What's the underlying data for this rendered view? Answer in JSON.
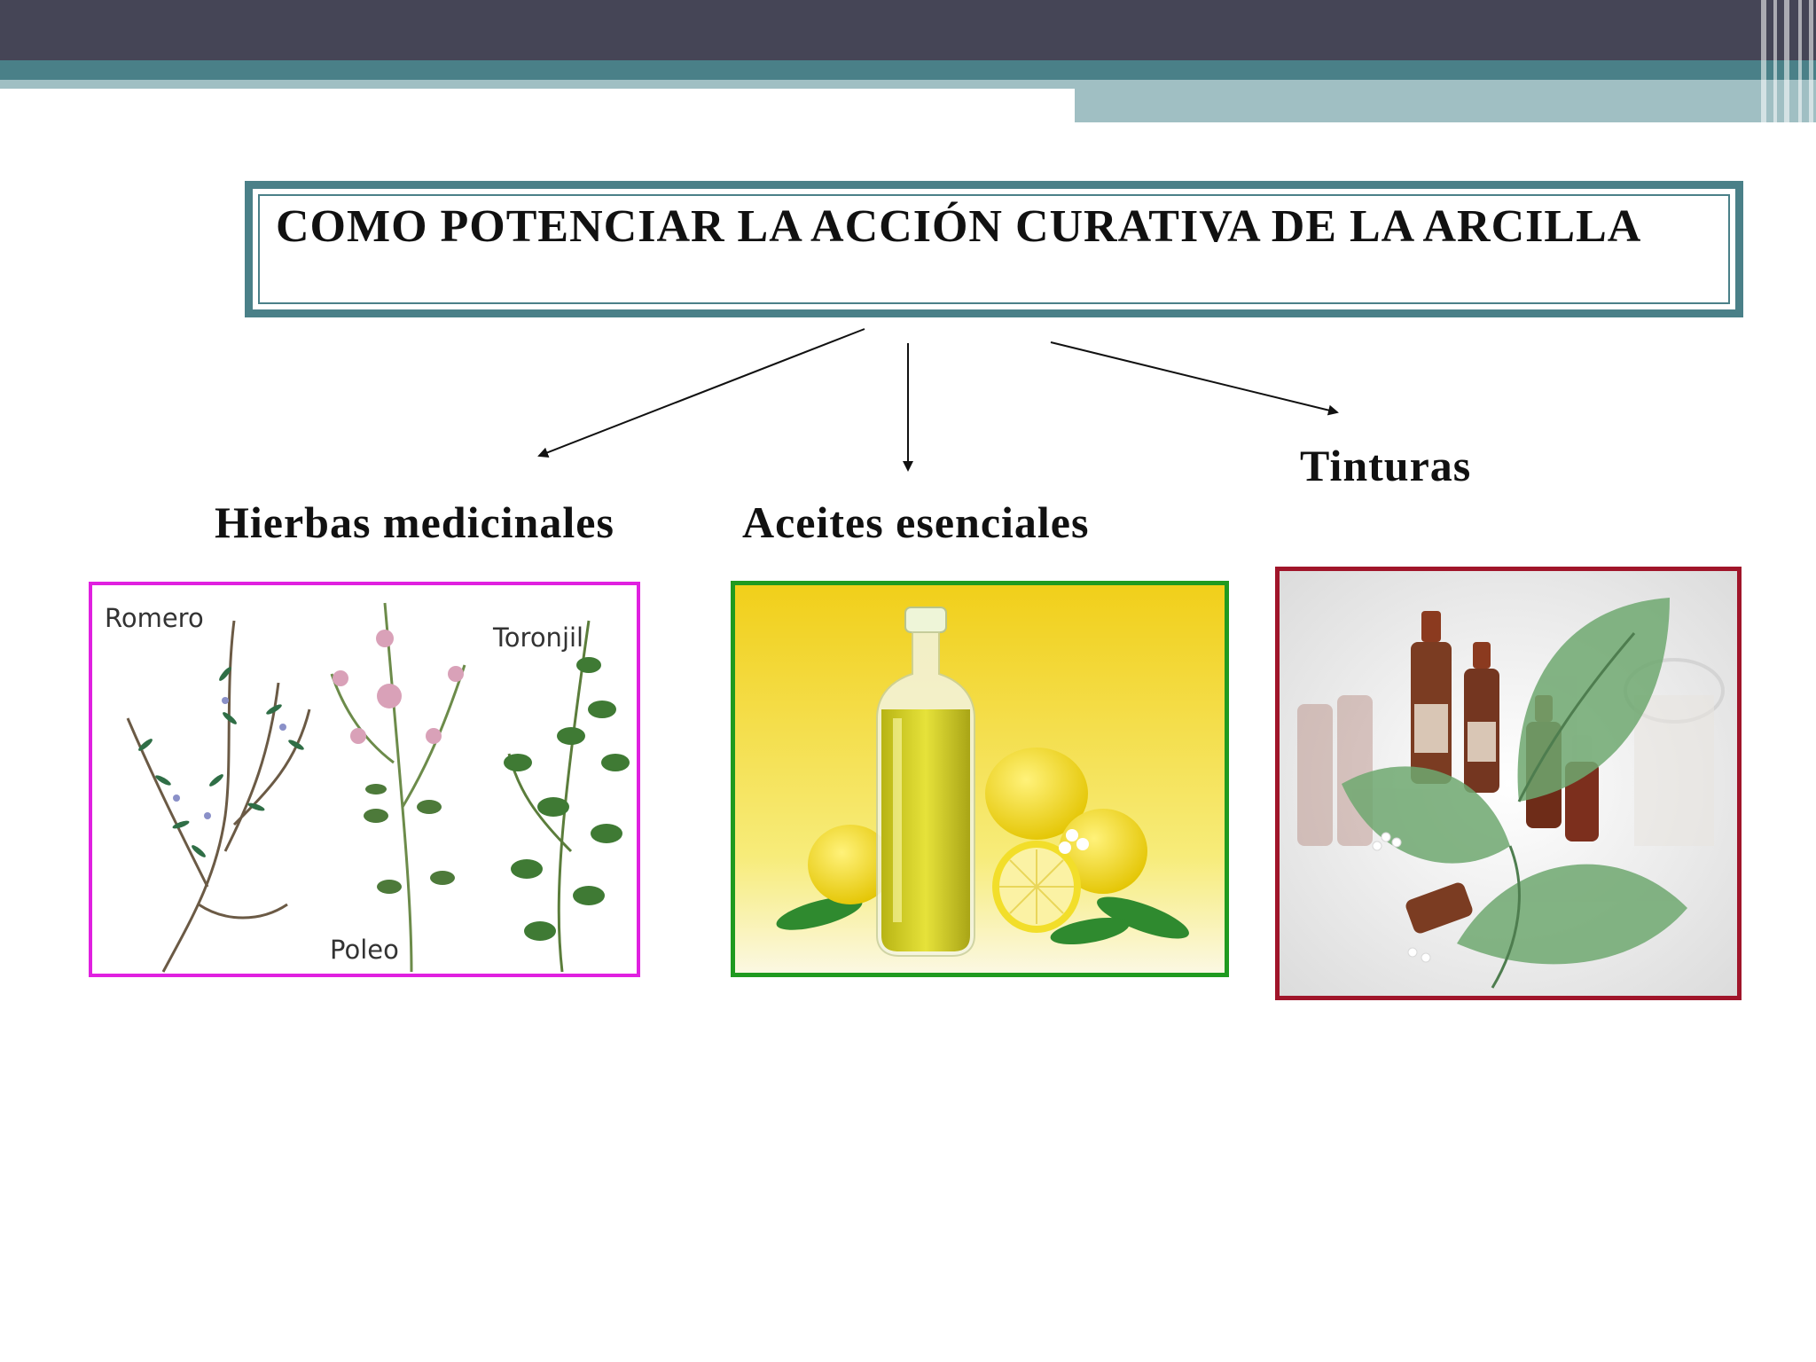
{
  "slide": {
    "title": "COMO POTENCIAR LA ACCIÓN CURATIVA DE LA ARCILLA",
    "branches": [
      {
        "label": "Hierbas medicinales"
      },
      {
        "label": "Aceites esenciales"
      },
      {
        "label": "Tinturas"
      }
    ],
    "herbs_image": {
      "names": [
        "Romero",
        "Toronjil",
        "Poleo"
      ],
      "border_color": "#e020e0"
    },
    "oils_image": {
      "border_color": "#1f9a1f"
    },
    "tinctures_image": {
      "border_color": "#a0152a"
    }
  },
  "theme": {
    "header_dark": "#454556",
    "header_teal": "#4a8088",
    "header_light": "#a0bfc3"
  }
}
